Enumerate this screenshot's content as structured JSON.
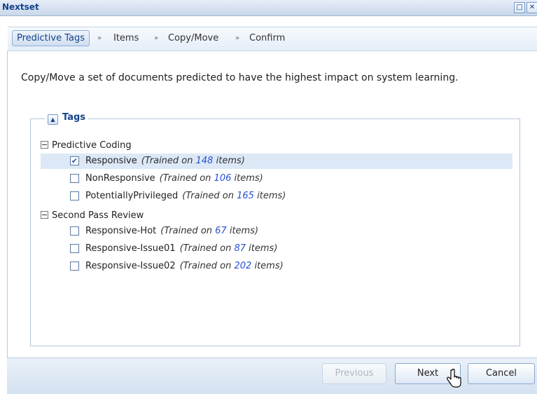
{
  "window": {
    "title": "Nextset"
  },
  "wizard": {
    "steps": [
      {
        "label": "Predictive Tags",
        "active": true
      },
      {
        "label": "Items",
        "active": false
      },
      {
        "label": "Copy/Move",
        "active": false
      },
      {
        "label": "Confirm",
        "active": false
      }
    ],
    "separator": "»"
  },
  "intro": "Copy/Move a set of documents predicted to have the highest impact on system learning.",
  "tags_section": {
    "legend": "Tags",
    "groups": [
      {
        "name": "Predictive Coding",
        "items": [
          {
            "label": "Responsive",
            "prefix": "(Trained on",
            "count": "148",
            "suffix": "items)",
            "checked": true,
            "selected": true
          },
          {
            "label": "NonResponsive",
            "prefix": "(Trained on",
            "count": "106",
            "suffix": "items)",
            "checked": false,
            "selected": false
          },
          {
            "label": "PotentiallyPrivileged",
            "prefix": "(Trained on",
            "count": "165",
            "suffix": "items)",
            "checked": false,
            "selected": false
          }
        ]
      },
      {
        "name": "Second Pass Review",
        "items": [
          {
            "label": "Responsive-Hot",
            "prefix": "(Trained on",
            "count": "67",
            "suffix": "items)",
            "checked": false,
            "selected": false
          },
          {
            "label": "Responsive-Issue01",
            "prefix": "(Trained on",
            "count": "87",
            "suffix": "items)",
            "checked": false,
            "selected": false
          },
          {
            "label": "Responsive-Issue02",
            "prefix": "(Trained on",
            "count": "202",
            "suffix": "items)",
            "checked": false,
            "selected": false
          }
        ]
      }
    ]
  },
  "buttons": {
    "previous": "Previous",
    "next": "Next",
    "cancel": "Cancel"
  },
  "colors": {
    "accent": "#15428b",
    "count": "#2a50d0",
    "selected_row": "#dce8f6"
  }
}
